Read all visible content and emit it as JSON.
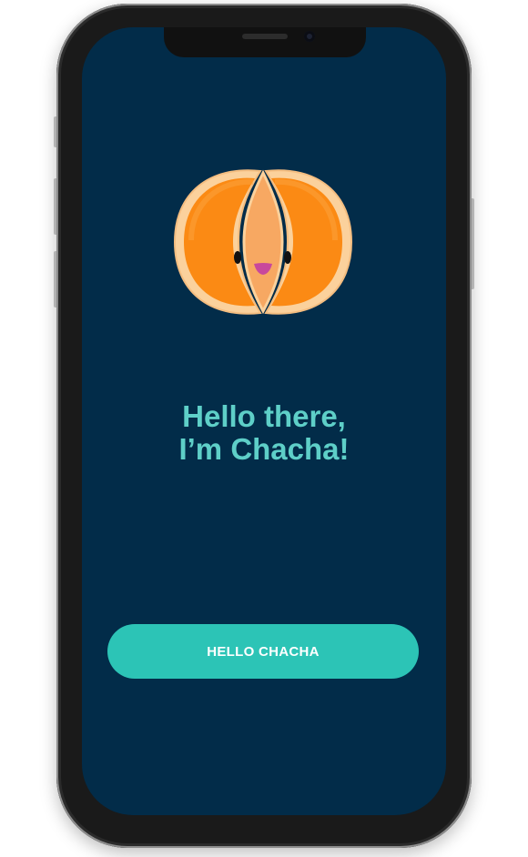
{
  "onboarding": {
    "greeting_line1": "Hello there,",
    "greeting_line2": "I’m Chacha!",
    "cta_label": "HELLO CHACHA"
  },
  "mascot": {
    "icon": "orange-mascot-icon"
  },
  "colors": {
    "screen_background": "#022c49",
    "greeting_text": "#5ecfc8",
    "button_background": "#2cc4b6",
    "button_text": "#ffffff",
    "mascot_orange": "#fb8a14"
  }
}
